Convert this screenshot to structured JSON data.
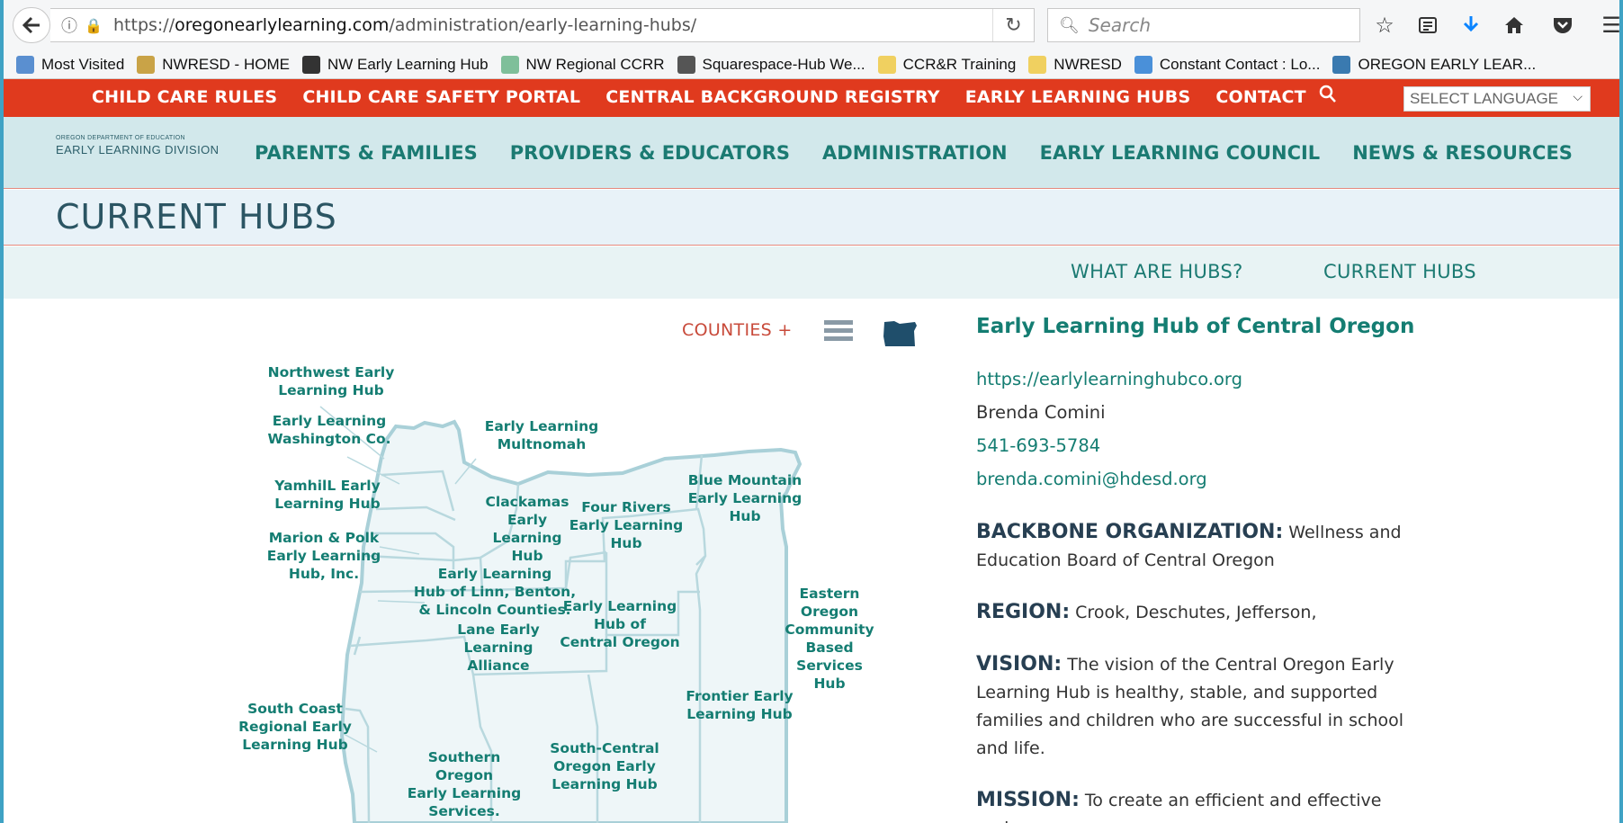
{
  "browser": {
    "url_prefix": "https://",
    "url_host": "oregonearlylearning.com",
    "url_path": "/administration/early-learning-hubs/",
    "search_placeholder": "Search",
    "bookmarks": [
      {
        "label": "Most Visited",
        "color": "#5a8fd0"
      },
      {
        "label": "NWRESD - HOME",
        "color": "#c9a347"
      },
      {
        "label": "NW Early Learning Hub",
        "color": "#333333"
      },
      {
        "label": "NW Regional CCRR",
        "color": "#7fbf9a"
      },
      {
        "label": "Squarespace-Hub We...",
        "color": "#555555"
      },
      {
        "label": "CCR&R Training",
        "color": "#f0d060"
      },
      {
        "label": "NWRESD",
        "color": "#f0d060"
      },
      {
        "label": "Constant Contact : Lo...",
        "color": "#4a90d9"
      },
      {
        "label": "OREGON EARLY LEAR...",
        "color": "#3a7ab0"
      }
    ]
  },
  "site": {
    "top_links": [
      "CHILD CARE RULES",
      "CHILD CARE SAFETY PORTAL",
      "CENTRAL BACKGROUND REGISTRY",
      "EARLY LEARNING HUBS",
      "CONTACT"
    ],
    "language_select": "SELECT LANGUAGE",
    "logo_small": "OREGON DEPARTMENT OF EDUCATION",
    "logo_big": "EARLY LEARNING DIVISION",
    "main_nav": [
      "PARENTS & FAMILIES",
      "PROVIDERS & EDUCATORS",
      "ADMINISTRATION",
      "EARLY LEARNING COUNCIL",
      "NEWS & RESOURCES"
    ],
    "page_title": "CURRENT HUBS",
    "sub_nav": [
      "WHAT ARE HUBS?",
      "CURRENT HUBS"
    ],
    "counties_toggle": "COUNTIES +"
  },
  "map": {
    "labels": [
      "Northwest Early\nLearning Hub",
      "Early Learning\nWashington Co.",
      "Early Learning\nMultnomah",
      "YamhilL Early\nLearning Hub",
      "Clackamas\nEarly\nLearning\nHub",
      "Four Rivers\nEarly Learning\nHub",
      "Blue Mountain\nEarly Learning\nHub",
      "Marion & Polk\nEarly Learning\nHub, Inc.",
      "Early Learning\nHub of Linn, Benton,\n& Lincoln Counties.",
      "Early Learning\nHub of\nCentral Oregon",
      "Lane Early\nLearning\nAlliance",
      "Eastern\nOregon\nCommunity\nBased\nServices\nHub",
      "Frontier Early\nLearning Hub",
      "South Coast\nRegional Early\nLearning Hub",
      "South-Central\nOregon Early\nLearning Hub",
      "Southern\nOregon\nEarly Learning\nServices."
    ]
  },
  "detail": {
    "name": "Early Learning Hub of Central Oregon",
    "website": "https://earlylearninghubco.org",
    "contact": "Brenda Comini",
    "phone": "541-693-5784",
    "email": "brenda.comini@hdesd.org",
    "backbone_label": "BACKBONE ORGANIZATION:",
    "backbone_value": " Wellness and Education Board of Central Oregon",
    "region_label": "REGION:",
    "region_value": " Crook, Deschutes, Jefferson,",
    "vision_label": "VISION:",
    "vision_value": " The vision of the Central Oregon Early Learning Hub is healthy, stable, and supported families and children who are successful in school and life.",
    "mission_label": "MISSION:",
    "mission_value": " To create an efficient and effective early"
  },
  "colors": {
    "red_bar": "#e03a1e",
    "teal": "#147d72",
    "nav_bg": "#d2e8eb",
    "map_fill": "#eef6f8",
    "map_stroke": "#a9d0d8"
  }
}
